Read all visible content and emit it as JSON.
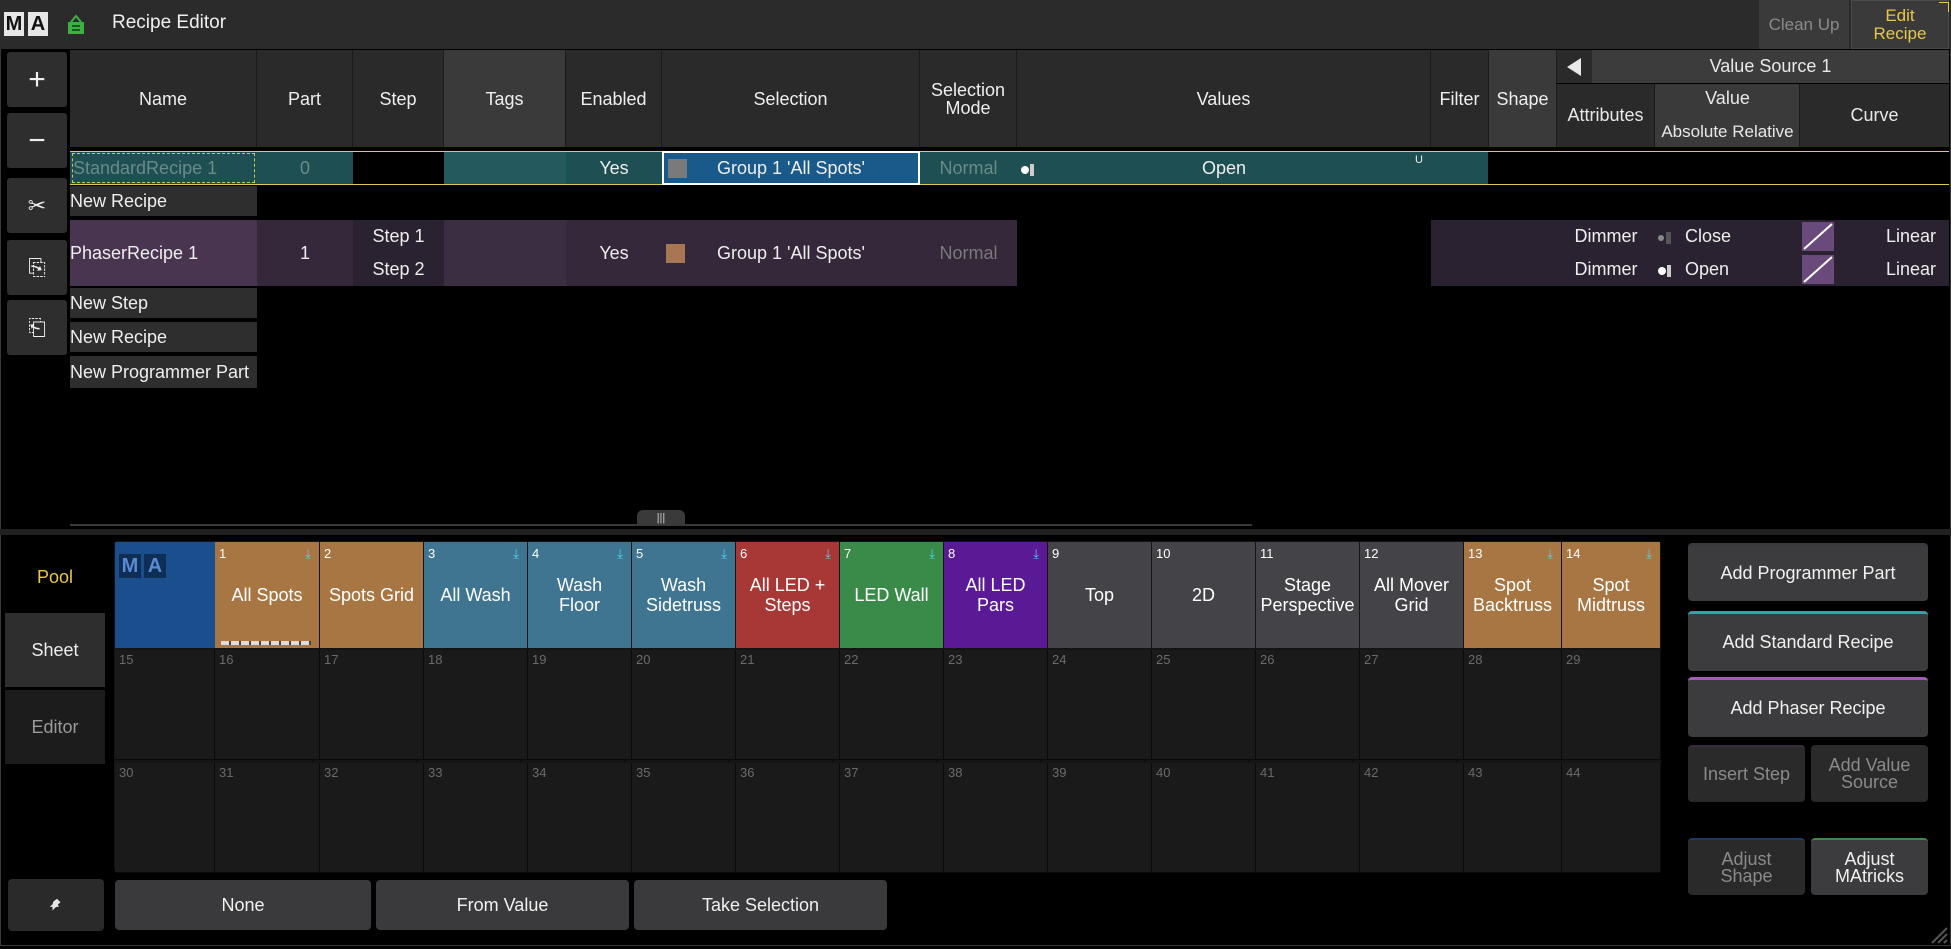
{
  "title": {
    "logo": [
      "M",
      "A"
    ],
    "name": "Recipe Editor",
    "clean_up": "Clean Up",
    "edit_recipe": [
      "Edit",
      "Recipe"
    ]
  },
  "toolbar": {
    "add": "+",
    "remove": "−",
    "cut": "✂",
    "copy": "⎘",
    "paste": "⎗"
  },
  "columns": {
    "name": "Name",
    "part": "Part",
    "step": "Step",
    "tags": "Tags",
    "enabled": "Enabled",
    "selection": "Selection",
    "selection_mode": [
      "Selection",
      "Mode"
    ],
    "values": "Values",
    "filter": "Filter",
    "shape": "Shape",
    "value_source": "Value Source 1",
    "attributes": "Attributes",
    "value": "Value",
    "value_sub": "Absolute Relative",
    "curve": "Curve"
  },
  "rows": {
    "standard": {
      "name": "StandardRecipe 1",
      "part": "0",
      "enabled": "Yes",
      "selection": "Group 1 'All Spots'",
      "mode": "Normal",
      "value": "Open",
      "value_flag": "U"
    },
    "new_recipe_1": "New Recipe",
    "phaser": {
      "name": "PhaserRecipe 1",
      "part": "1",
      "step1": "Step 1",
      "step2": "Step 2",
      "enabled": "Yes",
      "selection": "Group 1 'All Spots'",
      "mode": "Normal",
      "attr1": "Dimmer",
      "val1": "Close",
      "curve1": "Linear",
      "attr2": "Dimmer",
      "val2": "Open",
      "curve2": "Linear"
    },
    "new_step": "New Step",
    "new_recipe_2": "New Recipe",
    "new_programmer_part": "New Programmer Part"
  },
  "side_tabs": {
    "pool": "Pool",
    "sheet": "Sheet",
    "editor": "Editor"
  },
  "pool_logo": [
    "M",
    "A"
  ],
  "pool_items": [
    {
      "num": "1",
      "label": "All Spots",
      "color": "#a87642",
      "download": true
    },
    {
      "num": "2",
      "label": "Spots Grid",
      "color": "#a87642",
      "download": false
    },
    {
      "num": "3",
      "label": "All Wash",
      "color": "#3f7590",
      "download": true
    },
    {
      "num": "4",
      "label": "Wash Floor",
      "color": "#3f7590",
      "download": true
    },
    {
      "num": "5",
      "label": "Wash Sidetruss",
      "color": "#3f7590",
      "download": true
    },
    {
      "num": "6",
      "label": "All LED + Steps",
      "color": "#a83836",
      "download": true
    },
    {
      "num": "7",
      "label": "LED Wall",
      "color": "#3a8a4a",
      "download": true
    },
    {
      "num": "8",
      "label": "All LED Pars",
      "color": "#5a1a96",
      "download": true
    },
    {
      "num": "9",
      "label": "Top",
      "color": "#444448",
      "download": false
    },
    {
      "num": "10",
      "label": "2D",
      "color": "#444448",
      "download": false
    },
    {
      "num": "11",
      "label": "Stage Perspective",
      "color": "#444448",
      "download": false
    },
    {
      "num": "12",
      "label": "All Mover Grid",
      "color": "#444448",
      "download": false
    },
    {
      "num": "13",
      "label": "Spot Backtruss",
      "color": "#a87642",
      "download": true
    },
    {
      "num": "14",
      "label": "Spot Midtruss",
      "color": "#a87642",
      "download": true
    }
  ],
  "empty_row1": [
    "15",
    "16",
    "17",
    "18",
    "19",
    "20",
    "21",
    "22",
    "23",
    "24",
    "25",
    "26",
    "27",
    "28",
    "29"
  ],
  "empty_row2": [
    "30",
    "31",
    "32",
    "33",
    "34",
    "35",
    "36",
    "37",
    "38",
    "39",
    "40",
    "41",
    "42",
    "43",
    "44"
  ],
  "side_buttons": {
    "add_programmer_part": "Add Programmer Part",
    "add_standard_recipe": "Add Standard Recipe",
    "add_phaser_recipe": "Add Phaser Recipe",
    "insert_step": "Insert Step",
    "add_value_source": [
      "Add Value",
      "Source"
    ],
    "adjust_shape": [
      "Adjust",
      "Shape"
    ],
    "adjust_matricks": [
      "Adjust",
      "MAtricks"
    ]
  },
  "bottom_buttons": {
    "none": "None",
    "from_value": "From Value",
    "take_selection": "Take Selection"
  },
  "colors": {
    "accent_yellow": "#e8c74a",
    "selection_blue": "#1a5a8a",
    "standard_row": "#1e4f52",
    "phaser_row": "#4a3550"
  }
}
